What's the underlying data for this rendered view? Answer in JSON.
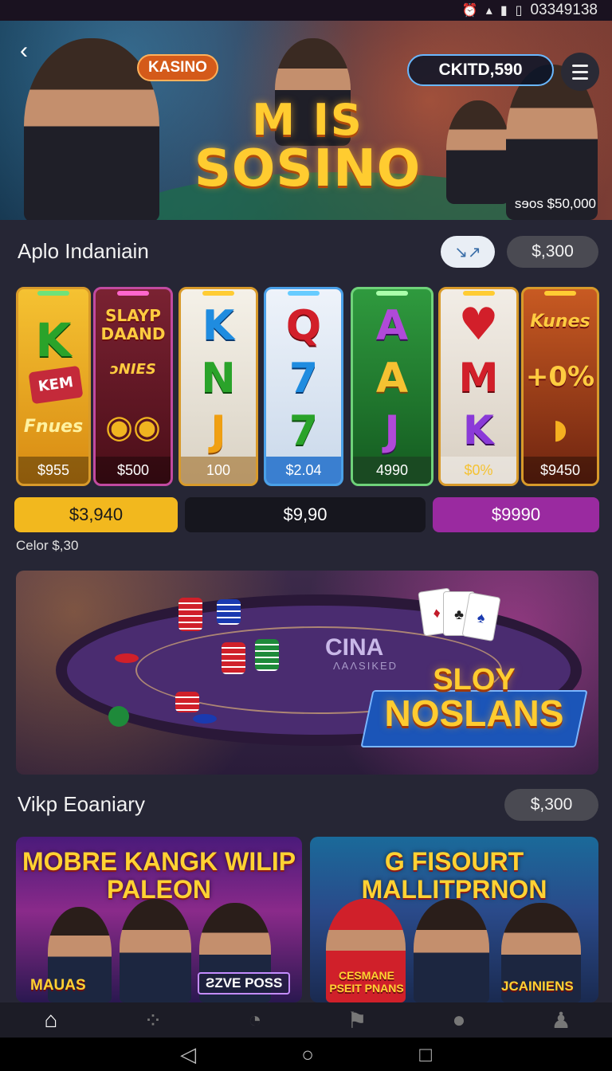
{
  "status_bar": {
    "time": "03349138"
  },
  "hero": {
    "brand": "KASINO",
    "balance": "CKITD,590",
    "logo_line1": "M  IS",
    "logo_line2": "SOSINO",
    "jackpot": "sɘos $50,000"
  },
  "section1": {
    "title": "Aplo Indaniain",
    "amount": "$,300"
  },
  "reels": [
    {
      "symbols": [
        "K",
        "KEM",
        "Fnues"
      ],
      "price": "$955",
      "bg": "#e0a020"
    },
    {
      "symbols": [
        "SLAYP DAAND",
        "ɔNIES",
        ""
      ],
      "price": "$500",
      "bg": "#6a1e2a"
    },
    {
      "symbols": [
        "K",
        "N",
        "J"
      ],
      "price": "100",
      "bg": "#e8e6e0"
    },
    {
      "symbols": [
        "Q",
        "7",
        "7"
      ],
      "price": "$2.04",
      "bg": "#dfe8f2"
    },
    {
      "symbols": [
        "A",
        "A",
        "J"
      ],
      "price": "4990",
      "bg": "#2d8a3a"
    },
    {
      "symbols": [
        "♥",
        "M",
        "K"
      ],
      "price": "$0%",
      "bg": "#e7e2dc"
    },
    {
      "symbols": [
        "Kunes",
        "+0%",
        ""
      ],
      "price": "$9450",
      "bg": "#b0461c"
    }
  ],
  "bets": [
    {
      "label": "$3,940",
      "color": "#f2b81e",
      "text": "#1a1a1a"
    },
    {
      "label": "$9,90",
      "color": "#16161e",
      "text": "#ffffff"
    },
    {
      "label": "$9990",
      "color": "#9a2aa0",
      "text": "#ffffff"
    }
  ],
  "color_note": "Celor $,30",
  "table_banner": {
    "felt_label": "CINA",
    "felt_sub": "ɅAɅSIKED",
    "logo_line1": "SLOY",
    "logo_line2": "NOSLANS"
  },
  "section2": {
    "title": "Vikp Eoaniary",
    "amount": "$,300"
  },
  "promos": [
    {
      "title": "MOBRE KANGK WILIP PALEON",
      "tag1": "MAUAS",
      "tag2": "ƧZVE POSS"
    },
    {
      "title": "G FISOURT MALLITPRNON",
      "tag1": "CESMANE PSEIT PNANS",
      "tag2": "JCAINIENS"
    }
  ],
  "nav": [
    "home-icon",
    "loader-icon",
    "clock-icon",
    "flag-icon",
    "user-icon",
    "profile-icon"
  ],
  "colors": {
    "background": "#262635",
    "accent": "#f2b81e",
    "purple": "#9a2aa0"
  }
}
